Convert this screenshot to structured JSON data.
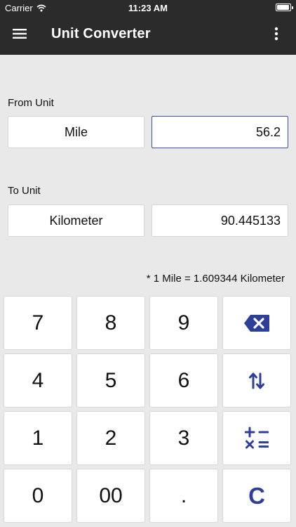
{
  "status_bar": {
    "carrier": "Carrier",
    "time": "11:23 AM"
  },
  "header": {
    "title": "Unit Converter",
    "menu_icon": "hamburger-menu-icon",
    "more_icon": "more-vertical-icon"
  },
  "from": {
    "label": "From Unit",
    "unit": "Mile",
    "value": "56.2"
  },
  "to": {
    "label": "To Unit",
    "unit": "Kilometer",
    "value": "90.445133"
  },
  "formula": "* 1 Mile = 1.609344 Kilometer",
  "keypad": {
    "k7": "7",
    "k8": "8",
    "k9": "9",
    "k4": "4",
    "k5": "5",
    "k6": "6",
    "k1": "1",
    "k2": "2",
    "k3": "3",
    "k0": "0",
    "k00": "00",
    "kdot": ".",
    "kclear": "C",
    "backspace_icon": "backspace-icon",
    "swap_icon": "swap-arrows-icon",
    "calculator_icon": "calculator-operators-icon"
  },
  "colors": {
    "header_bg": "#2b2b2b",
    "page_bg": "#e9e9e9",
    "accent": "#2d3f99",
    "active_border": "#3d50a9"
  }
}
